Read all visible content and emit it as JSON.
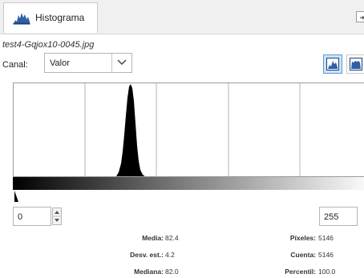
{
  "tab": {
    "label": "Histograma",
    "icon": "histogram-icon"
  },
  "tab_menu": {
    "icon": "tab-menu-arrow-icon"
  },
  "filename": "test4-Gqjox10-0045.jpg",
  "canal": {
    "label": "Canal:",
    "value": "Valor"
  },
  "view_buttons": {
    "linear": "linear-histogram-icon",
    "log": "log-histogram-icon"
  },
  "range": {
    "min": "0",
    "max": "255"
  },
  "stats_left": [
    {
      "label": "Media:",
      "value": "82.4"
    },
    {
      "label": "Desv. est.:",
      "value": "4.2"
    },
    {
      "label": "Mediana:",
      "value": "82.0"
    }
  ],
  "stats_right": [
    {
      "label": "Píxeles:",
      "value": "5146"
    },
    {
      "label": "Cuenta:",
      "value": "5146"
    },
    {
      "label": "Percentil:",
      "value": "100.0"
    }
  ]
}
